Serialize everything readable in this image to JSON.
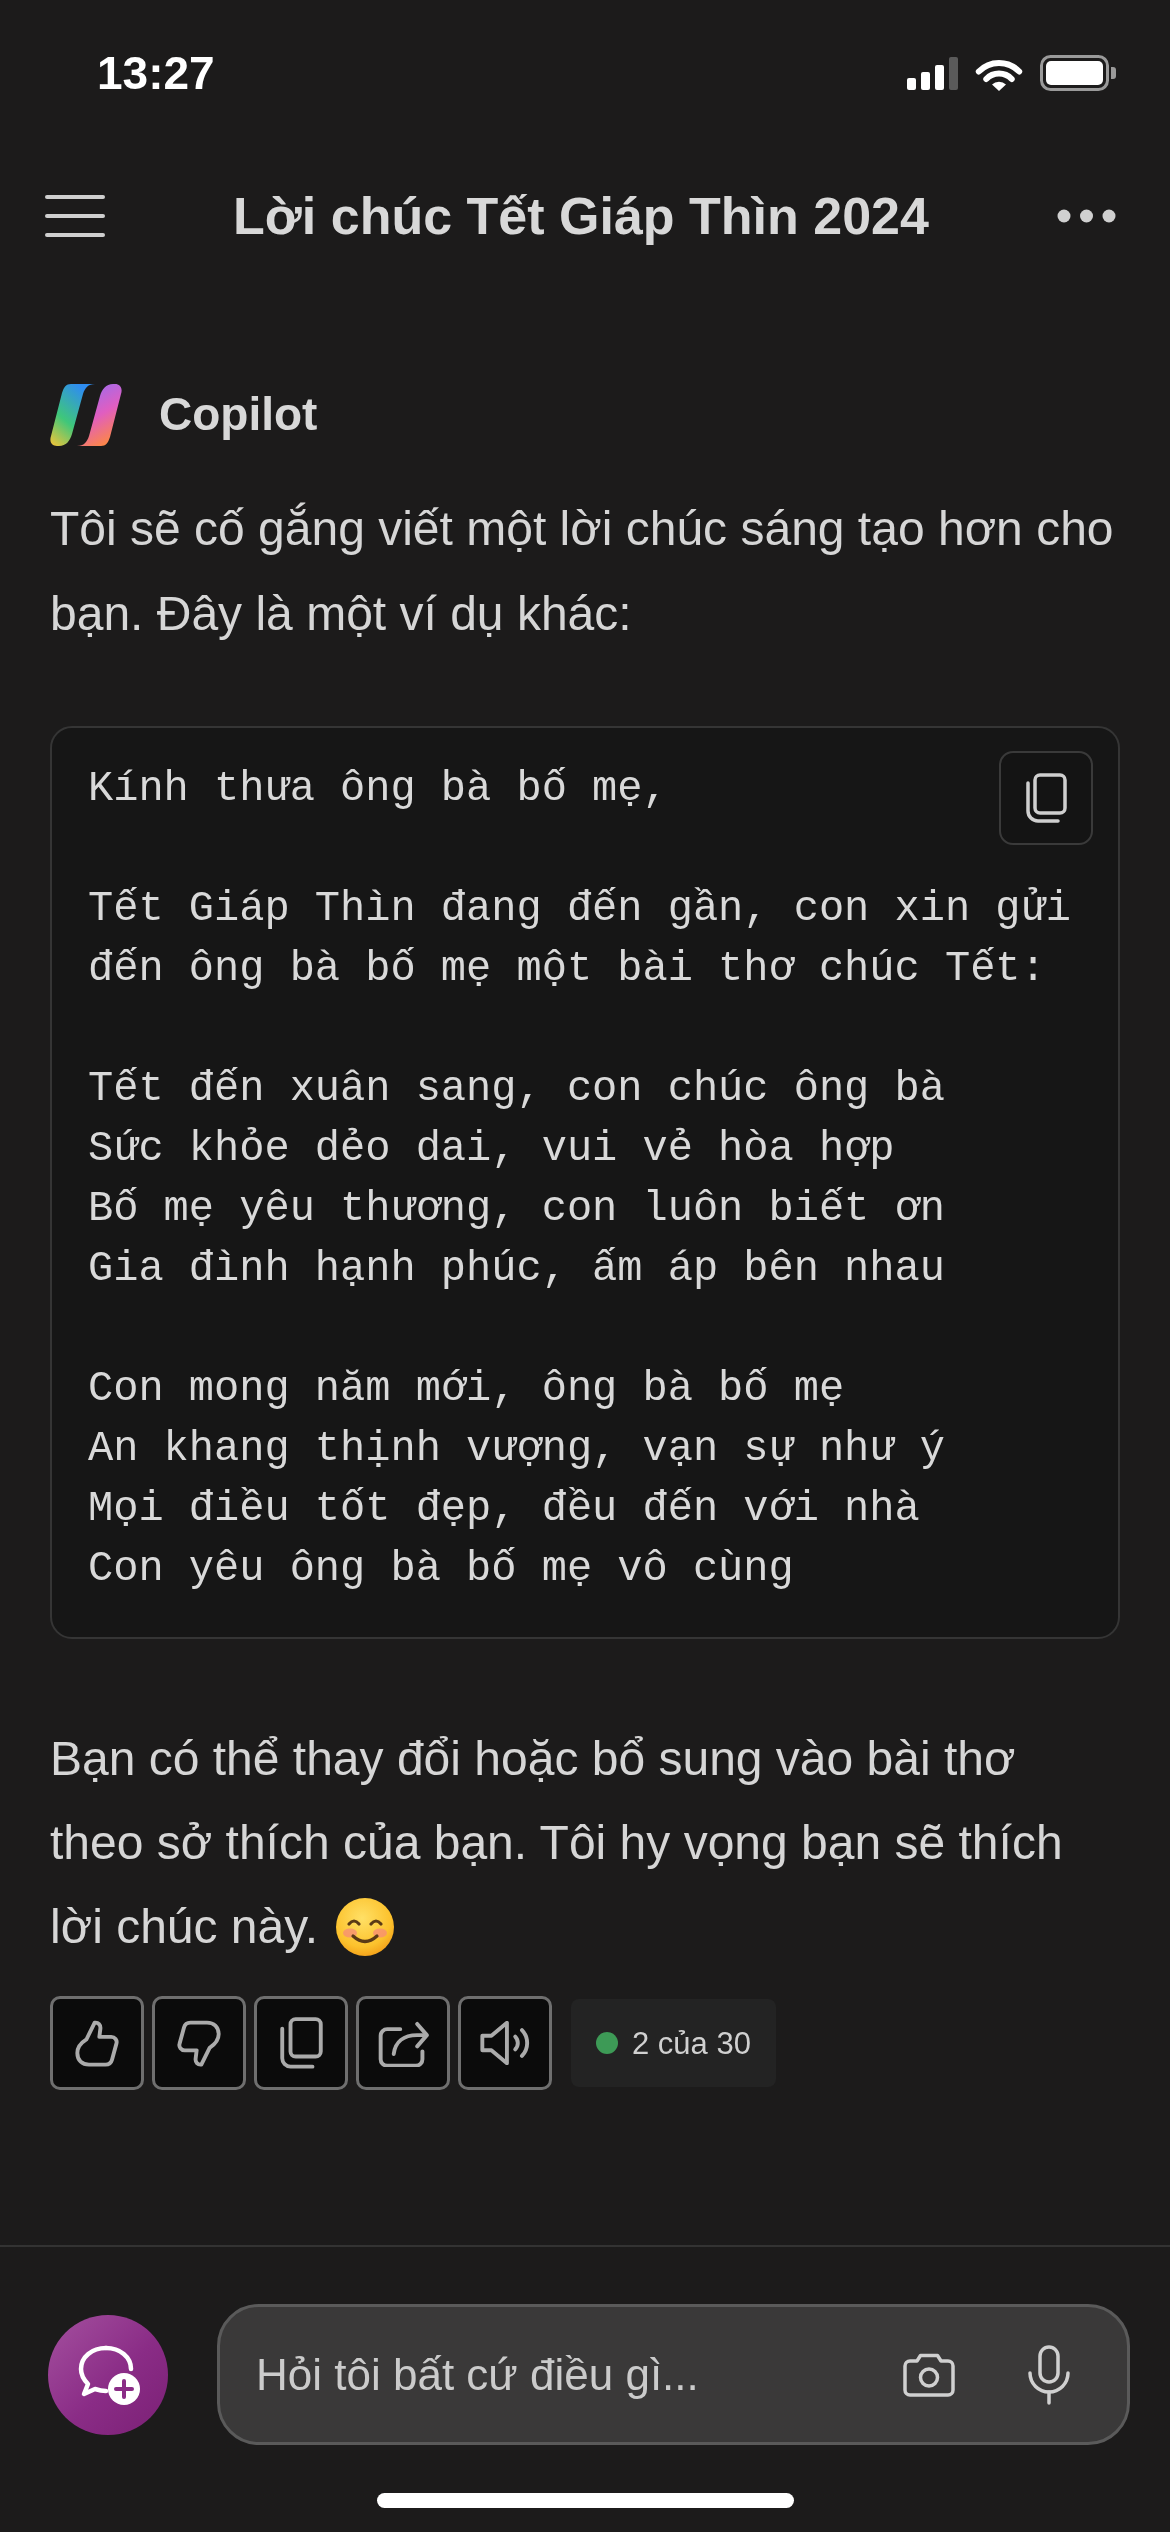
{
  "status_bar": {
    "time": "13:27"
  },
  "header": {
    "title": "Lời chúc Tết Giáp Thìn 2024"
  },
  "message": {
    "sender": "Copilot",
    "intro": "Tôi sẽ cố gắng viết một lời chúc sáng tạo hơn cho bạn. Đây là một ví dụ khác:",
    "code_block": {
      "stanzas": [
        {
          "lines": [
            "Kính thưa ông bà bố mẹ,"
          ]
        },
        {
          "lines": [
            "Tết Giáp Thìn đang đến gần, con xin gửi",
            "đến ông bà bố mẹ một bài thơ chúc Tết:"
          ]
        },
        {
          "lines": [
            "Tết đến xuân sang, con chúc ông bà",
            "Sức khỏe dẻo dai, vui vẻ hòa hợp",
            "Bố mẹ yêu thương, con luôn biết ơn",
            "Gia đình hạnh phúc, ấm áp bên nhau"
          ]
        },
        {
          "lines": [
            "Con mong năm mới, ông bà bố mẹ",
            "An khang thịnh vượng, vạn sự như ý",
            "Mọi điều tốt đẹp, đều đến với nhà",
            "Con yêu ông bà bố mẹ vô cùng"
          ]
        }
      ]
    },
    "closing_lines": [
      "Bạn có thể thay đổi hoặc bổ sung vào bài thơ",
      "theo sở thích của bạn. Tôi hy vọng bạn sẽ thích",
      "lời chúc này."
    ],
    "turn_counter": "2 của 30"
  },
  "composer": {
    "placeholder": "Hỏi tôi bất cứ điều gì..."
  }
}
